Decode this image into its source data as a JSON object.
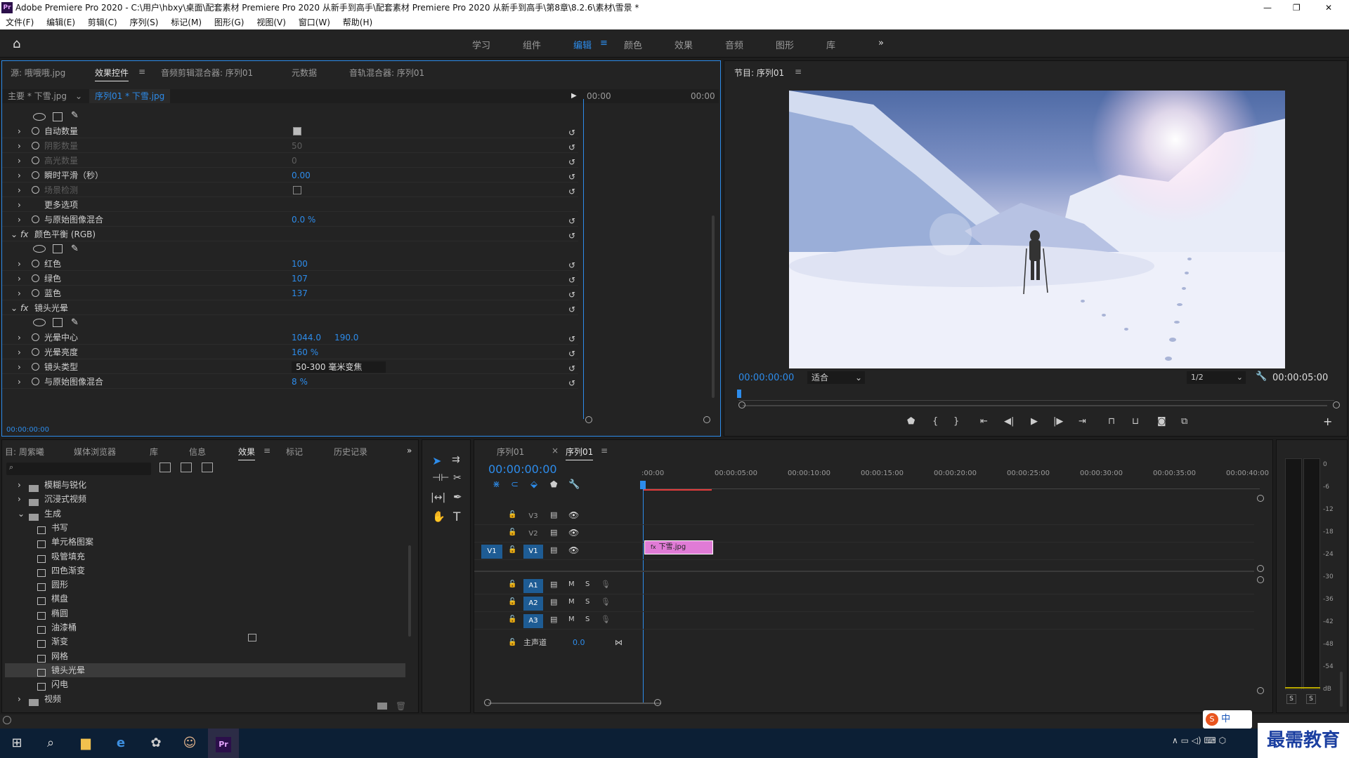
{
  "window": {
    "title": "Adobe Premiere Pro 2020 - C:\\用户\\hbxy\\桌面\\配套素材 Premiere Pro 2020 从新手到高手\\配套素材 Premiere Pro 2020 从新手到高手\\第8章\\8.2.6\\素材\\雪景 *",
    "app_icon": "Pr"
  },
  "menu": [
    "文件(F)",
    "编辑(E)",
    "剪辑(C)",
    "序列(S)",
    "标记(M)",
    "图形(G)",
    "视图(V)",
    "窗口(W)",
    "帮助(H)"
  ],
  "workspaces": [
    "学习",
    "组件",
    "编辑",
    "颜色",
    "效果",
    "音频",
    "图形",
    "库"
  ],
  "active_workspace": "编辑",
  "effect_panel": {
    "tabs": [
      "源: 哦哦哦.jpg",
      "效果控件",
      "音频剪辑混合器: 序列01",
      "元数据",
      "音轨混合器: 序列01"
    ],
    "master_label": "主要 * 下雪.jpg",
    "clip_label": "序列01 * 下雪.jpg",
    "tc_start": "00:00",
    "tc_end": "00:00",
    "footer_tc": "00:00:00:00",
    "rows": [
      {
        "name": "自动数量",
        "value": "checkbox",
        "indent": 1,
        "dim": false
      },
      {
        "name": "阴影数量",
        "value": "50",
        "indent": 1,
        "dim": true
      },
      {
        "name": "高光数量",
        "value": "0",
        "indent": 1,
        "dim": true
      },
      {
        "name": "瞬时平滑（秒）",
        "value": "0.00",
        "indent": 1,
        "dim": false
      },
      {
        "name": "场景检测",
        "value": "checkbox",
        "indent": 1,
        "dim": true
      },
      {
        "name": "更多选项",
        "value": "",
        "indent": 1,
        "dim": false
      },
      {
        "name": "与原始图像混合",
        "value": "0.0 %",
        "indent": 1,
        "dim": false
      },
      {
        "name": "颜色平衡 (RGB)",
        "value": "",
        "indent": 0,
        "dim": false
      },
      {
        "name": "masks",
        "value": "",
        "indent": 1,
        "dim": false
      },
      {
        "name": "红色",
        "value": "100",
        "indent": 1,
        "dim": false
      },
      {
        "name": "绿色",
        "value": "107",
        "indent": 1,
        "dim": false
      },
      {
        "name": "蓝色",
        "value": "137",
        "indent": 1,
        "dim": false
      },
      {
        "name": "镜头光晕",
        "value": "",
        "indent": 0,
        "dim": false
      },
      {
        "name": "masks",
        "value": "",
        "indent": 1,
        "dim": false
      },
      {
        "name": "光晕中心",
        "value": "1044.0     190.0",
        "indent": 1,
        "dim": false
      },
      {
        "name": "光晕亮度",
        "value": "160 %",
        "indent": 1,
        "dim": false
      },
      {
        "name": "镜头类型",
        "value": "50-300 毫米变焦",
        "indent": 1,
        "dim": false
      },
      {
        "name": "与原始图像混合",
        "value": "8 %",
        "indent": 1,
        "dim": false
      }
    ]
  },
  "program": {
    "title": "节目: 序列01",
    "timecode": "00:00:00:00",
    "fit": "适合",
    "resolution": "1/2",
    "duration": "00:00:05:00"
  },
  "project_panel": {
    "tabs": [
      "目: 周紫曦",
      "媒体浏览器",
      "库",
      "信息",
      "效果",
      "标记",
      "历史记录"
    ],
    "tree": [
      {
        "label": "模糊与锐化",
        "type": "folder",
        "level": 1
      },
      {
        "label": "沉浸式视频",
        "type": "folder",
        "level": 1
      },
      {
        "label": "生成",
        "type": "folder-open",
        "level": 1
      },
      {
        "label": "书写",
        "type": "fx",
        "level": 2
      },
      {
        "label": "单元格图案",
        "type": "fx",
        "level": 2
      },
      {
        "label": "吸管填充",
        "type": "fx",
        "level": 2
      },
      {
        "label": "四色渐变",
        "type": "fx",
        "level": 2
      },
      {
        "label": "圆形",
        "type": "fx",
        "level": 2
      },
      {
        "label": "棋盘",
        "type": "fx",
        "level": 2
      },
      {
        "label": "椭圆",
        "type": "fx",
        "level": 2
      },
      {
        "label": "油漆桶",
        "type": "fx",
        "level": 2
      },
      {
        "label": "渐变",
        "type": "fx",
        "level": 2
      },
      {
        "label": "网格",
        "type": "fx",
        "level": 2
      },
      {
        "label": "镜头光晕",
        "type": "fx",
        "level": 2,
        "selected": true
      },
      {
        "label": "闪电",
        "type": "fx",
        "level": 2
      },
      {
        "label": "视频",
        "type": "folder",
        "level": 1
      }
    ]
  },
  "timeline": {
    "tabs": [
      "序列01",
      "序列01"
    ],
    "timecode": "00:00:00:00",
    "ruler": [
      ":00:00",
      "00:00:05:00",
      "00:00:10:00",
      "00:00:15:00",
      "00:00:20:00",
      "00:00:25:00",
      "00:00:30:00",
      "00:00:35:00",
      "00:00:40:00"
    ],
    "tracks": [
      "V3",
      "V2",
      "V1",
      "A1",
      "A2",
      "A3"
    ],
    "master_label": "主声道",
    "master_value": "0.0",
    "clip_label": "下雪.jpg",
    "clip_fx": "fx"
  },
  "meter": {
    "scale": [
      "0",
      "-6",
      "-12",
      "-18",
      "-24",
      "-30",
      "-36",
      "-42",
      "-48",
      "-54",
      "dB"
    ],
    "buttons": [
      "S",
      "S"
    ]
  },
  "watermark": "最需教育",
  "ime": "中"
}
